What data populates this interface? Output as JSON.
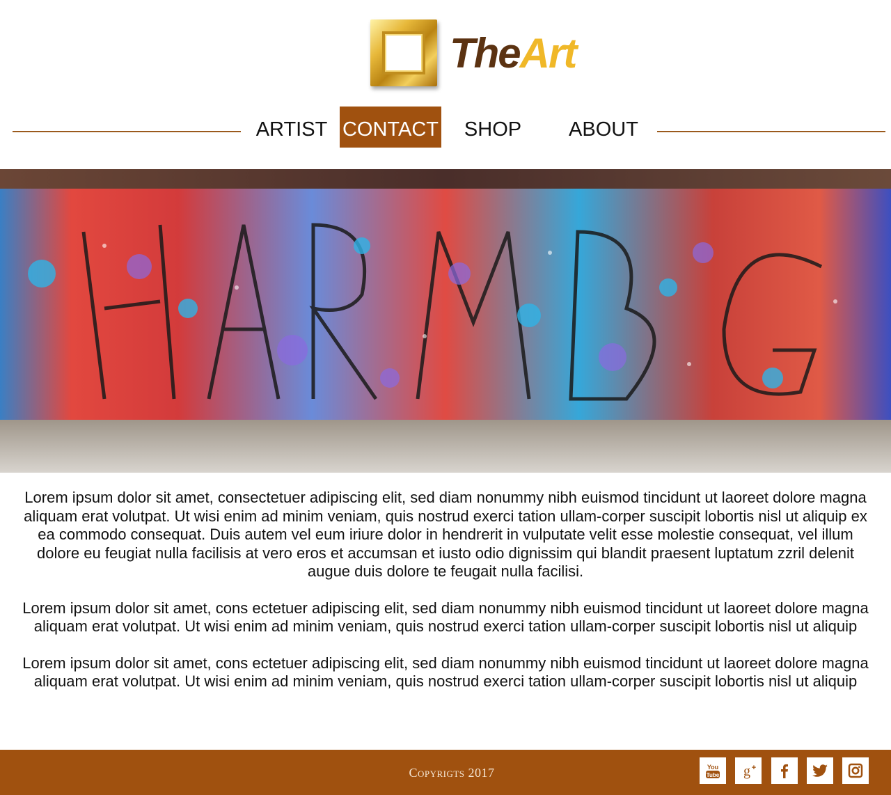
{
  "brand": {
    "word_the": "The",
    "word_art": "Art"
  },
  "nav": {
    "items": [
      {
        "label": "ARTIST",
        "active": false
      },
      {
        "label": "CONTACT",
        "active": true
      },
      {
        "label": "SHOP",
        "active": false
      },
      {
        "label": "ABOUT",
        "active": false
      }
    ]
  },
  "hero": {
    "image": "graffiti wall"
  },
  "content": {
    "paragraphs": [
      "Lorem ipsum dolor sit amet, consectetuer adipiscing elit, sed diam nonummy nibh euismod tincidunt ut laoreet dolore magna aliquam erat volutpat. Ut wisi enim ad minim veniam, quis nostrud exerci tation ullam-corper suscipit lobortis nisl ut aliquip ex ea commodo consequat. Duis autem vel eum iriure dolor in hendrerit in vulputate velit esse molestie consequat, vel illum dolore eu feugiat nulla facilisis at vero eros et accumsan et iusto odio dignissim qui blandit praesent luptatum zzril delenit augue duis dolore te feugait nulla facilisi.",
      "Lorem ipsum dolor sit amet, cons ectetuer adipiscing elit, sed diam nonummy nibh euismod tincidunt ut laoreet dolore magna aliquam erat volutpat. Ut wisi enim ad minim veniam, quis nostrud exerci tation ullam-corper suscipit lobortis nisl ut aliquip",
      "Lorem ipsum dolor sit amet, cons ectetuer adipiscing elit, sed diam nonummy nibh euismod tincidunt ut laoreet dolore magna aliquam erat volutpat. Ut wisi enim ad minim veniam, quis nostrud exerci tation ullam-corper suscipit lobortis nisl ut aliquip"
    ]
  },
  "footer": {
    "copyright": "Copyrigts 2017",
    "social": [
      {
        "name": "youtube-icon",
        "glyph": "You Tube"
      },
      {
        "name": "google-plus-icon",
        "glyph": "g+"
      },
      {
        "name": "facebook-icon",
        "glyph": "f"
      },
      {
        "name": "twitter-icon",
        "glyph": "bird"
      },
      {
        "name": "instagram-icon",
        "glyph": "camera"
      }
    ]
  },
  "colors": {
    "accent": "#a0510f",
    "rule": "#9b5a1d",
    "gold": "#f0b828",
    "brown": "#5b3211"
  }
}
